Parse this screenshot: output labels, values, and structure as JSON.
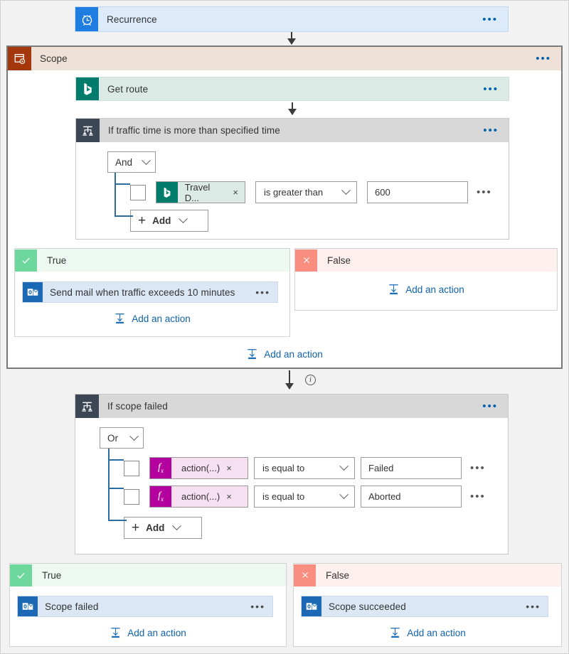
{
  "trigger": {
    "title": "Recurrence",
    "icon": "clock-icon",
    "overflow": "•••"
  },
  "scope": {
    "title": "Scope",
    "icon": "scope-icon",
    "overflow": "•••",
    "action": {
      "title": "Get route",
      "icon": "bing-maps-icon",
      "overflow": "•••"
    },
    "condition": {
      "title": "If traffic time is more than specified time",
      "icon": "condition-icon",
      "overflow": "•••",
      "logic_operator": "And",
      "rows": [
        {
          "token": "Travel D...",
          "token_icon": "bing-maps-icon",
          "token_remove": "×",
          "operator": "is greater than",
          "value": "600",
          "overflow": "•••"
        }
      ],
      "add_label": "Add",
      "add_plus": "+"
    },
    "true_branch": {
      "label": "True",
      "badge": "check-icon",
      "actions": [
        {
          "title": "Send mail when traffic exceeds 10 minutes",
          "icon": "outlook-icon",
          "overflow": "•••"
        }
      ],
      "add_action": "Add an action"
    },
    "false_branch": {
      "label": "False",
      "badge": "x-icon",
      "actions": [],
      "add_action": "Add an action"
    },
    "add_action": "Add an action"
  },
  "scope_failed_condition": {
    "title": "If scope failed",
    "icon": "condition-icon",
    "overflow": "•••",
    "logic_operator": "Or",
    "rows": [
      {
        "token": "action(...)",
        "token_icon": "fx-icon",
        "token_remove": "×",
        "operator": "is equal to",
        "value": "Failed",
        "overflow": "•••"
      },
      {
        "token": "action(...)",
        "token_icon": "fx-icon",
        "token_remove": "×",
        "operator": "is equal to",
        "value": "Aborted",
        "overflow": "•••"
      }
    ],
    "add_label": "Add",
    "add_plus": "+",
    "info_glyph": "i"
  },
  "bottom_true_branch": {
    "label": "True",
    "badge": "check-icon",
    "actions": [
      {
        "title": "Scope failed",
        "icon": "outlook-icon",
        "overflow": "•••"
      }
    ],
    "add_action": "Add an action"
  },
  "bottom_false_branch": {
    "label": "False",
    "badge": "x-icon",
    "actions": [
      {
        "title": "Scope succeeded",
        "icon": "outlook-icon",
        "overflow": "•••"
      }
    ],
    "add_action": "Add an action"
  },
  "colors": {
    "trigger_blue": "#dceafa",
    "trigger_icon_blue": "#1f7ce0",
    "scope_header": "#efe0d8",
    "scope_icon": "#a4370c",
    "bing_teal": "#007b6c",
    "condition_header": "#d8d8d8",
    "condition_icon": "#3b4754",
    "true_green": "#6ed79c",
    "false_red": "#f98e80",
    "action_blue": "#dbe7f4",
    "link_blue": "#0f62ad",
    "fx_magenta": "#b4009e"
  }
}
